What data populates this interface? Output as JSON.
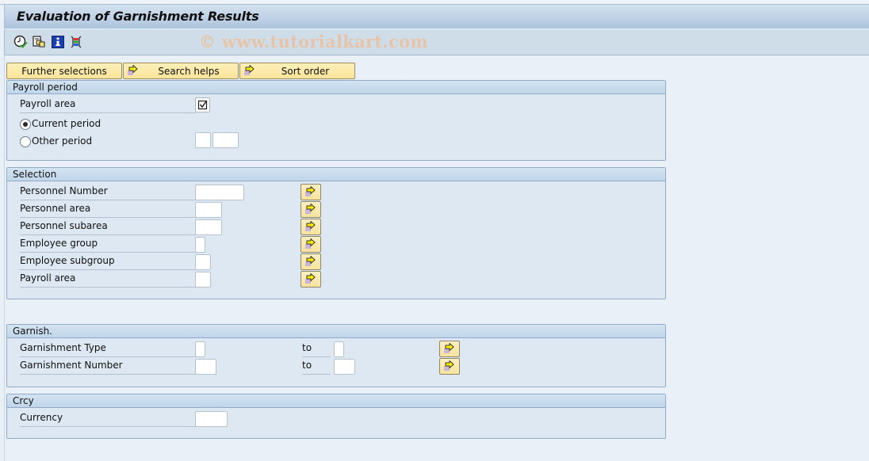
{
  "window": {
    "title": "Evaluation of Garnishment Results",
    "watermark": "© www.tutorialkart.com"
  },
  "toolbar": {
    "icons": [
      "execute-icon",
      "get-variant-icon",
      "program-info-icon",
      "selection-options-icon"
    ]
  },
  "tab_buttons": {
    "further_selections": "Further selections",
    "search_helps": "Search helps",
    "sort_order": "Sort order"
  },
  "payroll_period": {
    "header": "Payroll period",
    "payroll_area_label": "Payroll area",
    "payroll_area_checked": true,
    "current_period_label": "Current period",
    "other_period_label": "Other period",
    "selected_period": "current",
    "other_period_value_1": "",
    "other_period_value_2": ""
  },
  "selection": {
    "header": "Selection",
    "rows": [
      {
        "label": "Personnel Number",
        "value": ""
      },
      {
        "label": "Personnel area",
        "value": ""
      },
      {
        "label": "Personnel subarea",
        "value": ""
      },
      {
        "label": "Employee group",
        "value": ""
      },
      {
        "label": "Employee subgroup",
        "value": ""
      },
      {
        "label": "Payroll area",
        "value": ""
      }
    ]
  },
  "garnish": {
    "header": "Garnish.",
    "to_label": "to",
    "rows": [
      {
        "label": "Garnishment Type",
        "from": "",
        "to": ""
      },
      {
        "label": "Garnishment Number",
        "from": "",
        "to": ""
      }
    ]
  },
  "crcy": {
    "header": "Crcy",
    "currency_label": "Currency",
    "currency_value": ""
  }
}
